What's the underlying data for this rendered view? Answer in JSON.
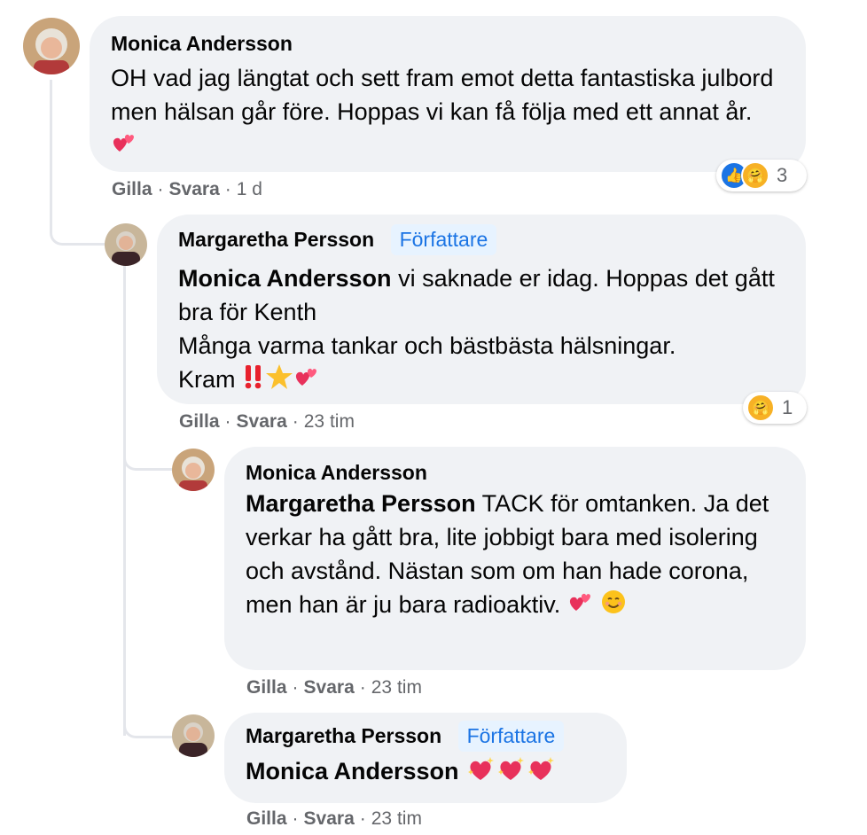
{
  "comments": [
    {
      "author": "Monica Andersson",
      "text": "OH vad jag längtat och sett fram emot detta fantastiska julbord men hälsan går före. Hoppas vi kan få följa med ett annat år.",
      "emoji": "two-hearts",
      "actions": {
        "like": "Gilla",
        "reply": "Svara",
        "time": "1 d"
      },
      "reactions": {
        "icons": [
          "like",
          "care"
        ],
        "count": "3"
      }
    },
    {
      "author": "Margaretha Persson",
      "badge": "Författare",
      "mention": "Monica Andersson",
      "text_1": "vi saknade er idag. Hoppas det gått bra för Kenth",
      "text_2": "Många varma tankar och bästbästa hälsningar.",
      "text_3": "Kram",
      "emojis": [
        "double-exclamation",
        "star",
        "two-hearts"
      ],
      "actions": {
        "like": "Gilla",
        "reply": "Svara",
        "time": "23 tim"
      },
      "reactions": {
        "icons": [
          "care"
        ],
        "count": "1"
      }
    },
    {
      "author": "Monica Andersson",
      "mention": "Margaretha Persson",
      "text": "TACK för omtanken. Ja det verkar ha gått bra, lite jobbigt bara med isolering och avstånd. Nästan som om han hade corona, men han är ju bara radioaktiv.",
      "emojis": [
        "two-hearts",
        "smiling-face"
      ],
      "actions": {
        "like": "Gilla",
        "reply": "Svara",
        "time": "23 tim"
      }
    },
    {
      "author": "Margaretha Persson",
      "badge": "Författare",
      "mention": "Monica Andersson",
      "emojis": [
        "sparkling-heart",
        "sparkling-heart",
        "sparkling-heart"
      ],
      "actions": {
        "like": "Gilla",
        "reply": "Svara",
        "time": "23 tim"
      }
    }
  ],
  "separator": "·",
  "colors": {
    "bubble": "#f0f2f5",
    "meta": "#65676b",
    "badge_bg": "#e7f3ff",
    "badge_text": "#1b74e4",
    "like": "#1b74e4",
    "care": "#f7b125"
  }
}
